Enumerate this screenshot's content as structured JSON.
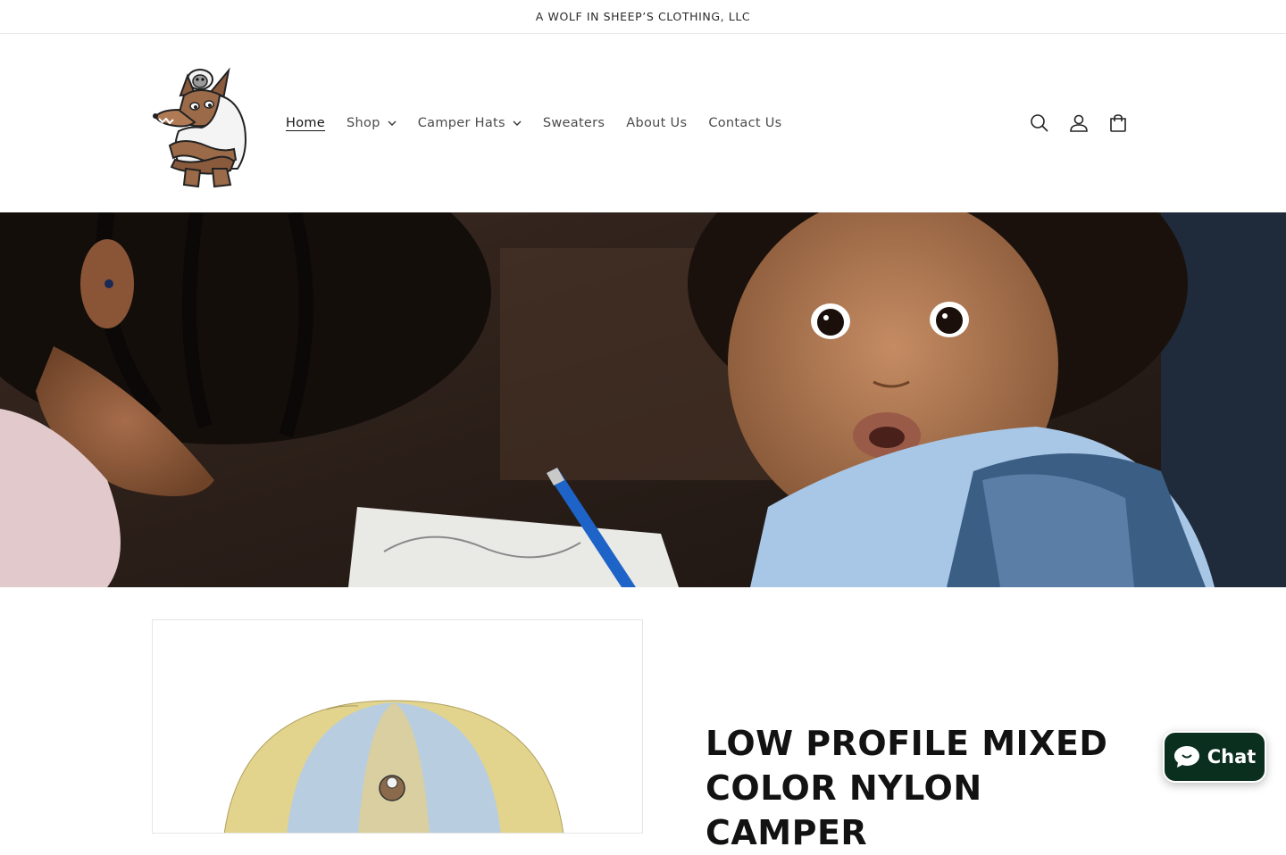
{
  "announcement": {
    "text": "A WOLF IN SHEEP’S CLOTHING, LLC"
  },
  "nav": {
    "items": [
      {
        "label": "Home",
        "active": true,
        "dropdown": false
      },
      {
        "label": "Shop",
        "active": false,
        "dropdown": true
      },
      {
        "label": "Camper Hats",
        "active": false,
        "dropdown": true
      },
      {
        "label": "Sweaters",
        "active": false,
        "dropdown": false
      },
      {
        "label": "About Us",
        "active": false,
        "dropdown": false
      },
      {
        "label": "Contact Us",
        "active": false,
        "dropdown": false
      }
    ]
  },
  "header_icons": [
    "search-icon",
    "account-icon",
    "cart-icon"
  ],
  "product": {
    "title": "LOW PROFILE MIXED COLOR NYLON CAMPER"
  },
  "chat": {
    "label": "Chat",
    "icon": "chat-bubble-icon",
    "color": "#0b2f1f"
  }
}
